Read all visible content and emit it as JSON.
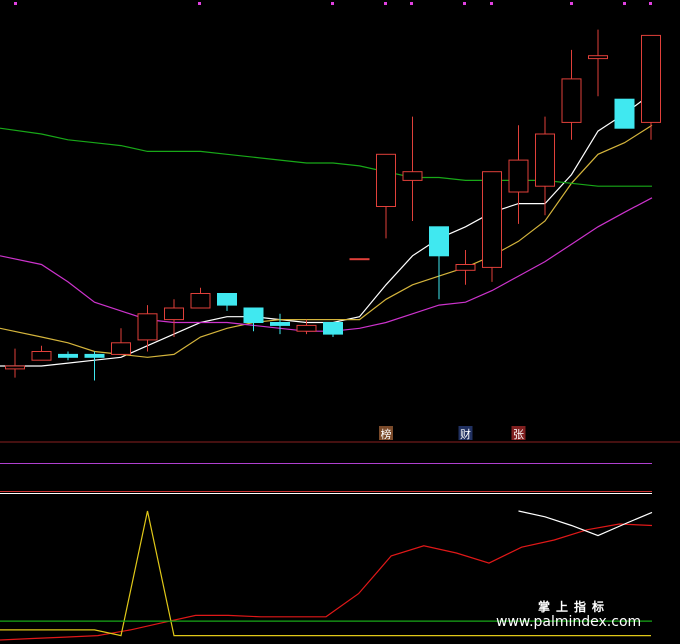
{
  "chart_data": {
    "type": "candlestick",
    "title": "",
    "xlabel": "",
    "ylabel": "",
    "price_range": [
      0,
      100
    ],
    "grid": false,
    "candles": [
      {
        "o": 9,
        "h": 16,
        "l": 6,
        "c": 10
      },
      {
        "o": 12,
        "h": 17,
        "l": 12,
        "c": 15
      },
      {
        "o": 14,
        "h": 15,
        "l": 12,
        "c": 13
      },
      {
        "o": 14,
        "h": 15,
        "l": 5,
        "c": 13
      },
      {
        "o": 14,
        "h": 23,
        "l": 14,
        "c": 18
      },
      {
        "o": 19,
        "h": 31,
        "l": 15,
        "c": 28
      },
      {
        "o": 26,
        "h": 33,
        "l": 20,
        "c": 30
      },
      {
        "o": 30,
        "h": 37,
        "l": 30,
        "c": 35
      },
      {
        "o": 35,
        "h": 35,
        "l": 29,
        "c": 31
      },
      {
        "o": 30,
        "h": 30,
        "l": 22,
        "c": 25
      },
      {
        "o": 25,
        "h": 28,
        "l": 21,
        "c": 24
      },
      {
        "o": 22,
        "h": 26,
        "l": 21,
        "c": 24
      },
      {
        "o": 25,
        "h": 25,
        "l": 20,
        "c": 21
      },
      {
        "o": 47,
        "h": 47,
        "l": 47,
        "c": 47
      },
      {
        "o": 65,
        "h": 83,
        "l": 54,
        "c": 83
      },
      {
        "o": 74,
        "h": 96,
        "l": 60,
        "c": 77
      },
      {
        "o": 58,
        "h": 58,
        "l": 33,
        "c": 48
      },
      {
        "o": 43,
        "h": 50,
        "l": 38,
        "c": 45
      },
      {
        "o": 44,
        "h": 77,
        "l": 39,
        "c": 77
      },
      {
        "o": 70,
        "h": 93,
        "l": 59,
        "c": 81
      },
      {
        "o": 72,
        "h": 96,
        "l": 62,
        "c": 90
      },
      {
        "o": 94,
        "h": 119,
        "l": 88,
        "c": 109
      },
      {
        "o": 116,
        "h": 126,
        "l": 103,
        "c": 117
      },
      {
        "o": 102,
        "h": 102,
        "l": 92,
        "c": 92
      },
      {
        "o": 94,
        "h": 123,
        "l": 88,
        "c": 124
      }
    ],
    "ma_lines": [
      {
        "color": "#ffffff",
        "values": [
          10,
          10,
          11,
          12,
          13,
          17,
          21,
          25,
          27,
          27,
          26,
          25,
          25,
          27,
          38,
          48,
          54,
          58,
          63,
          66,
          66,
          76,
          91,
          97,
          104
        ]
      },
      {
        "color": "#d4b43c",
        "values": [
          23,
          20,
          18,
          15,
          14,
          13,
          14,
          20,
          23,
          25,
          26,
          26,
          26,
          26,
          33,
          38,
          41,
          44,
          48,
          53,
          60,
          73,
          83,
          87,
          93
        ]
      },
      {
        "color": "#18a818",
        "values": [
          92,
          90,
          88,
          87,
          86,
          84,
          84,
          84,
          83,
          82,
          81,
          80,
          80,
          79,
          77,
          75,
          75,
          74,
          74,
          74,
          74,
          73,
          72,
          72,
          72
        ]
      },
      {
        "color": "#cc33cc",
        "values": [
          48,
          45,
          39,
          32,
          29,
          26,
          25,
          25,
          25,
          24,
          23,
          22,
          22,
          23,
          25,
          28,
          31,
          32,
          36,
          41,
          46,
          52,
          58,
          63,
          68
        ]
      }
    ],
    "event_tags": [
      {
        "index": 14,
        "text": "榜",
        "color": "#ffffff",
        "bg": "#7a4a2a"
      },
      {
        "index": 17,
        "text": "财",
        "color": "#ffffff",
        "bg": "#203060"
      },
      {
        "index": 19,
        "text": "张",
        "color": "#ffffff",
        "bg": "#802020"
      }
    ],
    "indicator": {
      "range": [
        0,
        100
      ],
      "series": [
        {
          "color": "#e01818",
          "values": [
            0,
            1,
            2,
            3,
            7,
            12,
            17,
            17,
            16,
            16,
            16,
            32,
            58,
            65,
            60,
            53,
            64,
            69,
            76,
            80,
            79
          ]
        },
        {
          "color": "#ffffff",
          "values": [
            null,
            null,
            null,
            null,
            null,
            null,
            null,
            null,
            null,
            null,
            null,
            null,
            null,
            null,
            null,
            null,
            null,
            null,
            null,
            89,
            85,
            79,
            72,
            80,
            88
          ]
        },
        {
          "color": "#e0c818",
          "values": [
            7,
            7,
            7,
            7,
            3,
            89,
            3,
            3,
            3,
            3,
            3,
            3,
            3,
            3,
            3,
            3,
            3,
            3,
            3,
            3,
            3,
            3,
            3,
            3,
            3
          ]
        },
        {
          "color": "#18a818",
          "values": [
            13,
            13,
            13,
            13,
            13,
            13,
            13,
            13,
            13,
            13,
            13,
            13,
            13,
            13,
            13,
            13,
            13,
            13,
            13,
            13,
            13,
            13,
            13,
            13,
            13
          ]
        }
      ]
    }
  },
  "watermark": {
    "line1": "掌上指标",
    "line2": "www.palmindex.com"
  }
}
